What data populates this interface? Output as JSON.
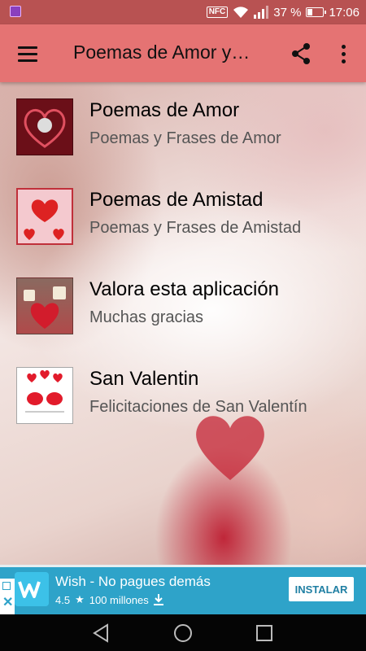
{
  "status_bar": {
    "nfc": "NFC",
    "battery": "37 %",
    "time": "17:06"
  },
  "app_bar": {
    "title": "Poemas de Amor y…",
    "menu_icon": "hamburger-menu-icon",
    "share_icon": "share-icon",
    "more_icon": "more-vert-icon"
  },
  "items": [
    {
      "title": "Poemas de Amor",
      "subtitle": "Poemas y Frases de Amor"
    },
    {
      "title": "Poemas de Amistad",
      "subtitle": "Poemas y Frases de Amistad"
    },
    {
      "title": "Valora esta aplicación",
      "subtitle": "Muchas gracias"
    },
    {
      "title": "San Valentin",
      "subtitle": "Felicitaciones de San Valentín"
    }
  ],
  "ad": {
    "app_name": "Wish - No pagues demás",
    "rating": "4.5",
    "downloads": "100 millones",
    "install_label": "INSTALAR"
  },
  "colors": {
    "status_bar": "#b85252",
    "app_bar": "#e57373",
    "ad_banner": "#2ea3c9"
  }
}
